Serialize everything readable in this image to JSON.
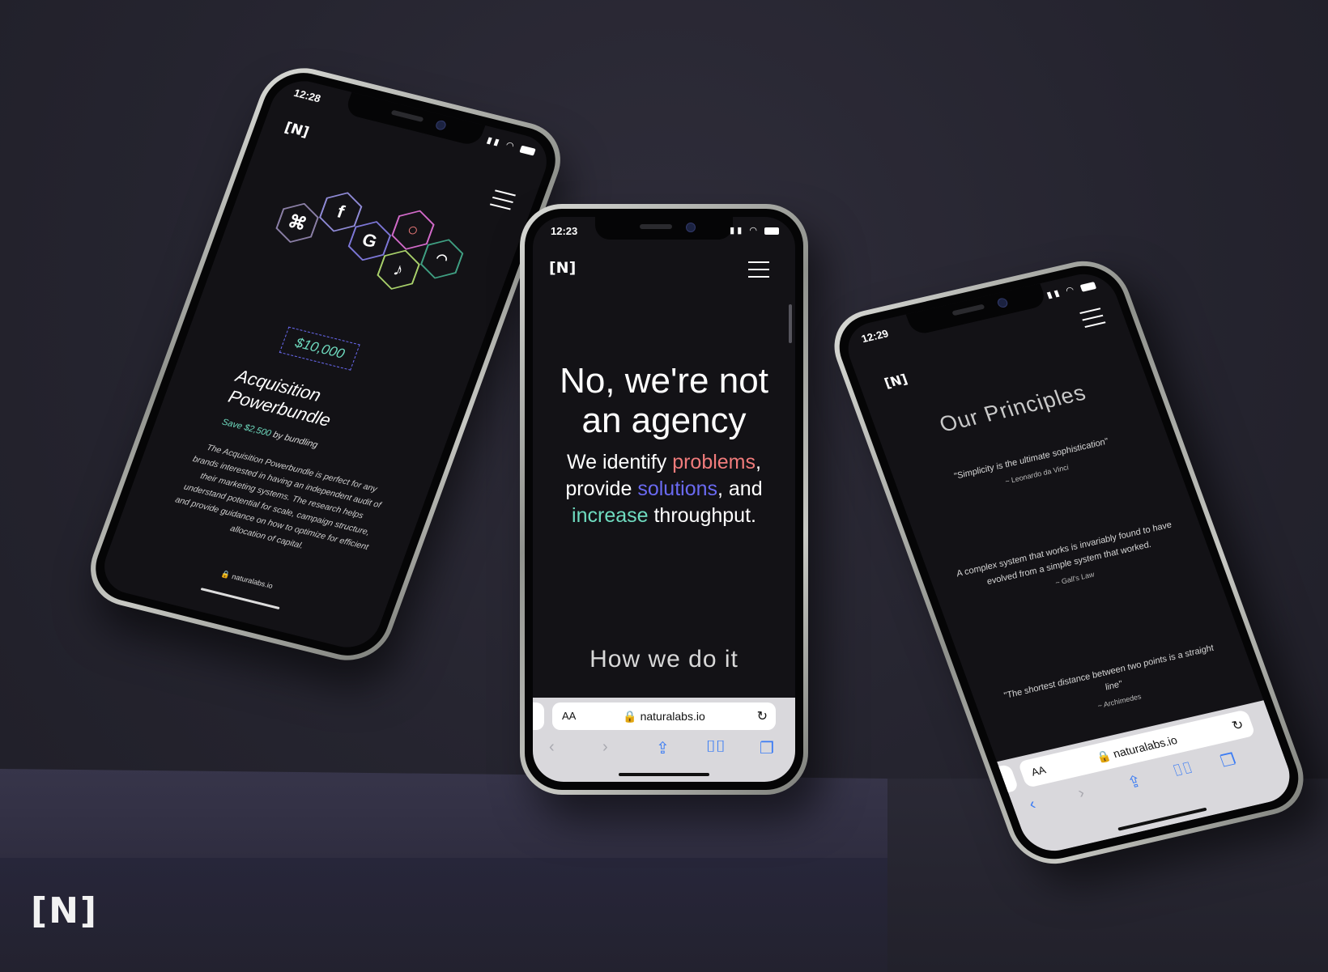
{
  "brand": {
    "logo_text": "[N]"
  },
  "center_phone": {
    "status_time": "12:23",
    "logo": "[N]",
    "menu_icon": "hamburger-icon",
    "hero_title_line1": "No, we're not",
    "hero_title_line2": "an agency",
    "hero_sub": {
      "p1": "We identify ",
      "w1": "problems",
      "p2": ",",
      "p3": "provide ",
      "w2": "solutions",
      "p4": ", and",
      "w3": "increase",
      "p5": " throughput."
    },
    "section_heading": "How we do it",
    "browser": {
      "aa": "AA",
      "url": "naturalabs.io",
      "reload_icon": "reload-icon",
      "nav_icons": [
        "back-icon",
        "forward-icon",
        "share-icon",
        "bookmarks-icon",
        "tabs-icon"
      ]
    }
  },
  "left_phone": {
    "status_time": "12:28",
    "logo": "[N]",
    "price": "$10,000",
    "product_title_line1": "Acquisition",
    "product_title_line2": "Powerbundle",
    "save_highlight": "Save $2,500",
    "save_rest": " by bundling",
    "description": "The Acquisition Powerbundle is perfect for any brands interested in having an independent audit of their marketing systems. The research helps understand potential for scale, campaign structure, and provide guidance on how to optimize for efficient allocation of capital.",
    "url": "naturalabs.io",
    "hex_icons": [
      "network-icon",
      "facebook-icon",
      "google-icon",
      "instagram-icon",
      "podcast-icon",
      "tiktok-icon"
    ]
  },
  "right_phone": {
    "status_time": "12:29",
    "logo": "[N]",
    "title": "Our Principles",
    "quotes": [
      {
        "text": "\"Simplicity is the ultimate sophistication\"",
        "author": "~ Leonardo da Vinci"
      },
      {
        "text": "A complex system that works is invariably found to have evolved from a simple system that worked.",
        "author": "~ Gall's Law"
      },
      {
        "text": "\"The shortest distance between two points is a straight line\"",
        "author": "~ Archimedes"
      }
    ],
    "browser": {
      "aa": "AA",
      "url": "naturalabs.io"
    }
  },
  "colors": {
    "red": "#f07b7b",
    "blue": "#6a6af2",
    "green": "#6fdcc0",
    "background": "#25242f"
  }
}
